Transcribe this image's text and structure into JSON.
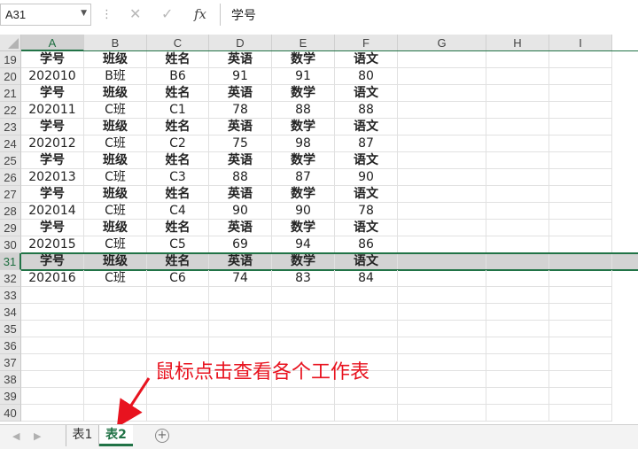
{
  "formula_bar": {
    "cell_ref": "A31",
    "cancel_icon": "close-icon",
    "enter_icon": "check-icon",
    "function_label": "fx",
    "content": "学号"
  },
  "columns": [
    "A",
    "B",
    "C",
    "D",
    "E",
    "F",
    "G",
    "H",
    "I"
  ],
  "selected_column": "A",
  "rows": [
    {
      "n": "19",
      "cells": [
        "学号",
        "班级",
        "姓名",
        "英语",
        "数学",
        "语文"
      ],
      "header": true
    },
    {
      "n": "20",
      "cells": [
        "202010",
        "B班",
        "B6",
        "91",
        "91",
        "80"
      ],
      "header": false
    },
    {
      "n": "21",
      "cells": [
        "学号",
        "班级",
        "姓名",
        "英语",
        "数学",
        "语文"
      ],
      "header": true
    },
    {
      "n": "22",
      "cells": [
        "202011",
        "C班",
        "C1",
        "78",
        "88",
        "88"
      ],
      "header": false
    },
    {
      "n": "23",
      "cells": [
        "学号",
        "班级",
        "姓名",
        "英语",
        "数学",
        "语文"
      ],
      "header": true
    },
    {
      "n": "24",
      "cells": [
        "202012",
        "C班",
        "C2",
        "75",
        "98",
        "87"
      ],
      "header": false
    },
    {
      "n": "25",
      "cells": [
        "学号",
        "班级",
        "姓名",
        "英语",
        "数学",
        "语文"
      ],
      "header": true
    },
    {
      "n": "26",
      "cells": [
        "202013",
        "C班",
        "C3",
        "88",
        "87",
        "90"
      ],
      "header": false
    },
    {
      "n": "27",
      "cells": [
        "学号",
        "班级",
        "姓名",
        "英语",
        "数学",
        "语文"
      ],
      "header": true
    },
    {
      "n": "28",
      "cells": [
        "202014",
        "C班",
        "C4",
        "90",
        "90",
        "78"
      ],
      "header": false
    },
    {
      "n": "29",
      "cells": [
        "学号",
        "班级",
        "姓名",
        "英语",
        "数学",
        "语文"
      ],
      "header": true
    },
    {
      "n": "30",
      "cells": [
        "202015",
        "C班",
        "C5",
        "69",
        "94",
        "86"
      ],
      "header": false
    },
    {
      "n": "31",
      "cells": [
        "学号",
        "班级",
        "姓名",
        "英语",
        "数学",
        "语文"
      ],
      "header": true,
      "selected": true
    },
    {
      "n": "32",
      "cells": [
        "202016",
        "C班",
        "C6",
        "74",
        "83",
        "84"
      ],
      "header": false
    },
    {
      "n": "33",
      "cells": [],
      "header": false
    },
    {
      "n": "34",
      "cells": [],
      "header": false
    },
    {
      "n": "35",
      "cells": [],
      "header": false
    },
    {
      "n": "36",
      "cells": [],
      "header": false
    },
    {
      "n": "37",
      "cells": [],
      "header": false
    },
    {
      "n": "38",
      "cells": [],
      "header": false
    },
    {
      "n": "39",
      "cells": [],
      "header": false
    },
    {
      "n": "40",
      "cells": [],
      "header": false
    }
  ],
  "annotation": {
    "text": "鼠标点击查看各个工作表",
    "color": "#e8131f"
  },
  "sheets": [
    {
      "name": "表1",
      "active": false
    },
    {
      "name": "表2",
      "active": true
    }
  ],
  "add_sheet_icon": "plus-circle-icon",
  "colors": {
    "accent": "#217346",
    "selected_row": "#d3d3d3",
    "annotation": "#e8131f"
  }
}
